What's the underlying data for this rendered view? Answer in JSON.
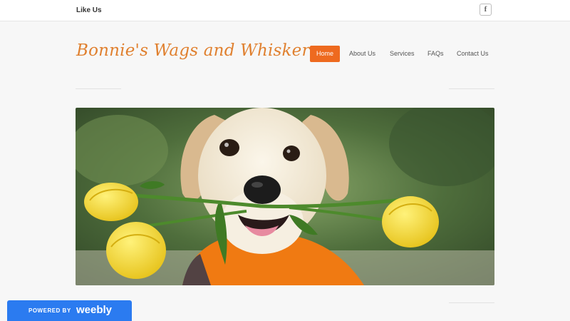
{
  "topbar": {
    "like_label": "Like Us",
    "facebook_glyph": "f",
    "facebook_icon": "facebook-icon"
  },
  "header": {
    "site_title": "Bonnie's Wags and Whiskers",
    "title_color": "#e0802f"
  },
  "nav": {
    "items": [
      {
        "label": "Home",
        "active": true
      },
      {
        "label": "About Us",
        "active": false
      },
      {
        "label": "Services",
        "active": false
      },
      {
        "label": "FAQs",
        "active": false
      },
      {
        "label": "Contact Us",
        "active": false
      }
    ],
    "active_color": "#ee6a1f"
  },
  "hero": {
    "subject": "puppy-with-yellow-roses-image"
  },
  "badge": {
    "powered_by": "POWERED BY",
    "brand": "weebly",
    "color": "#2b7bf0"
  }
}
